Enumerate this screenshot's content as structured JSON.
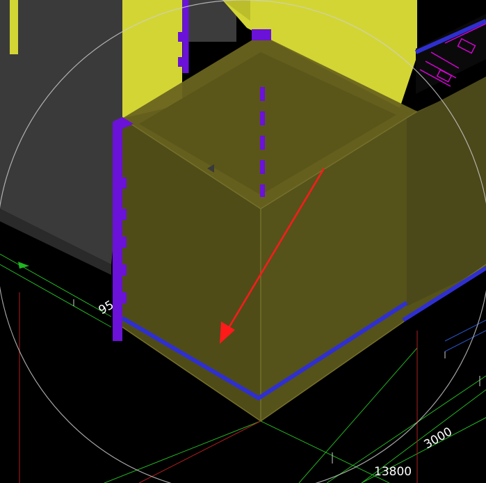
{
  "viewport": {
    "background": "#000000",
    "dimension_labels": {
      "a": "3000",
      "b": "13800",
      "c": "95"
    },
    "colors": {
      "gray_wall": "#3a3a3a",
      "yellow": "#d3d535",
      "olive": "#55521a",
      "olive_dark": "#48451a",
      "olive_light": "#6a6420",
      "blue": "#2f2fd0",
      "purple": "#6a12d8",
      "arrow": "#ff1a1a",
      "grid_green": "#21b521",
      "grid_red": "#b21e1e",
      "grid_blue": "#2a55c9",
      "magenta": "#e000e0",
      "circle": "#d0d0d0"
    }
  }
}
